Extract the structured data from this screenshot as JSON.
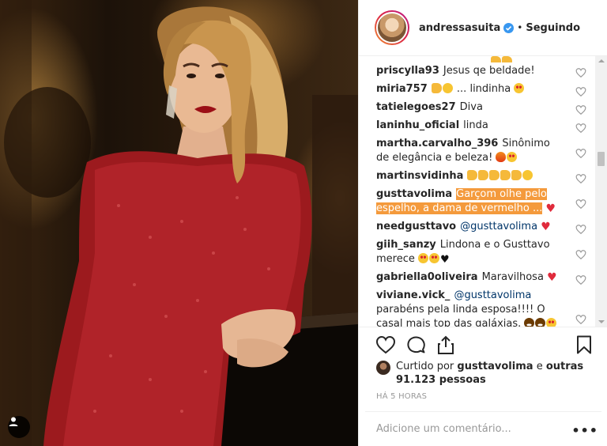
{
  "post": {
    "username": "andressasuita",
    "follow_label": "Seguindo",
    "separator": "•"
  },
  "comments": [
    {
      "user": "priscylla93",
      "text": "Jesus qe beldade!"
    },
    {
      "user": "miria757",
      "pre": "",
      "text": "... lindinha",
      "emoji_before": [
        "clap",
        "face"
      ],
      "emoji_after": [
        "star-face"
      ]
    },
    {
      "user": "tatielegoes27",
      "text": "Diva"
    },
    {
      "user": "laninhu_oficial",
      "text": "linda"
    },
    {
      "user": "martha.carvalho_396",
      "text": "Sinônimo de elegância e beleza!",
      "emoji_after": [
        "fire",
        "star-face"
      ]
    },
    {
      "user": "martinsvidinha",
      "emoji_after": [
        "clap",
        "clap",
        "clap",
        "clap",
        "clap",
        "face"
      ]
    },
    {
      "user": "gusttavolima",
      "text": "Garçom olhe pelo espelho, a dama de vermelho ...",
      "highlighted": true,
      "emoji_after": [
        "heart-red"
      ]
    },
    {
      "user": "needgusttavo",
      "mention": "@gusttavolima",
      "emoji_after": [
        "heart-red"
      ]
    },
    {
      "user": "giih_sanzy",
      "text": "Lindona e o Gusttavo merece",
      "emoji_after": [
        "star-face",
        "star-face",
        "heart-black"
      ]
    },
    {
      "user": "gabriella0oliveira",
      "text": "Maravilhosa",
      "emoji_after": [
        "heart-red"
      ]
    },
    {
      "user": "viviane.vick_",
      "mention": "@gusttavolima",
      "text": "parabéns pela linda esposa!!!! O casal mais top das galáxias.",
      "emoji_after": [
        "grin",
        "grin",
        "star-face",
        "star-face",
        "heart-black",
        "heart-black",
        "clap",
        "clap",
        "clap"
      ]
    }
  ],
  "actions": {
    "like_icon": "heart-outline-icon",
    "comment_icon": "comment-bubble-icon",
    "share_icon": "share-icon",
    "save_icon": "bookmark-icon"
  },
  "likes": {
    "prefix": "Curtido por",
    "liker": "gusttavolima",
    "connector": "e",
    "others": "outras 91.123 pessoas"
  },
  "timestamp": "HÁ 5 HORAS",
  "add_comment": {
    "placeholder": "Adicione um comentário...",
    "more_label": "•••"
  },
  "colors": {
    "highlight": "#f49a3c",
    "verified": "#3897f0",
    "mention": "#003569",
    "muted": "#999999"
  }
}
